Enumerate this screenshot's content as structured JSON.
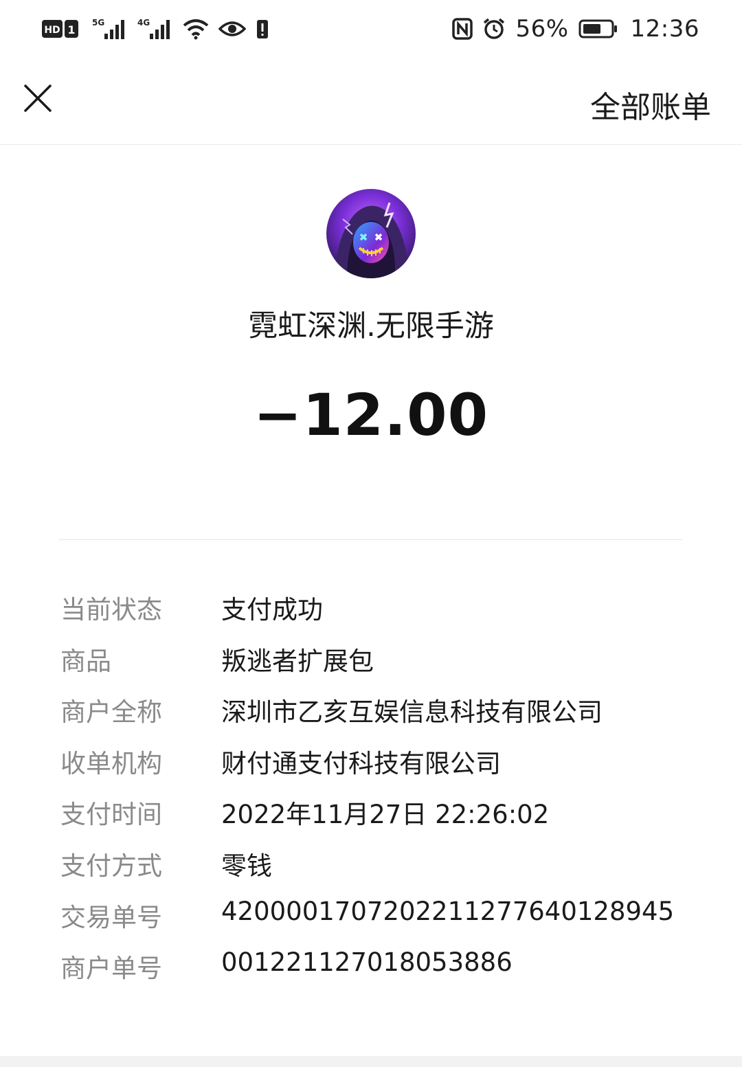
{
  "status_bar": {
    "battery_percent": "56%",
    "time": "12:36",
    "icons": [
      "hd-icon",
      "sim-1-icon",
      "signal-5g-icon",
      "signal-4g-icon",
      "wifi-icon",
      "eye-icon",
      "alert-icon",
      "nfc-icon",
      "alarm-icon",
      "battery-icon"
    ]
  },
  "header": {
    "close_icon": "close-icon",
    "all_bills_label": "全部账单"
  },
  "merchant": {
    "name": "霓虹深渊.无限手游",
    "amount": "−12.00"
  },
  "details": [
    {
      "label": "当前状态",
      "value": "支付成功"
    },
    {
      "label": "商品",
      "value": "叛逃者扩展包"
    },
    {
      "label": "商户全称",
      "value": "深圳市乙亥互娱信息科技有限公司"
    },
    {
      "label": "收单机构",
      "value": "财付通支付科技有限公司"
    },
    {
      "label": "支付时间",
      "value": "2022年11月27日 22:26:02"
    },
    {
      "label": "支付方式",
      "value": "零钱"
    },
    {
      "label": "交易单号",
      "value": "4200001707202211277640128945"
    },
    {
      "label": "商户单号",
      "value": "001221127018053886"
    }
  ]
}
